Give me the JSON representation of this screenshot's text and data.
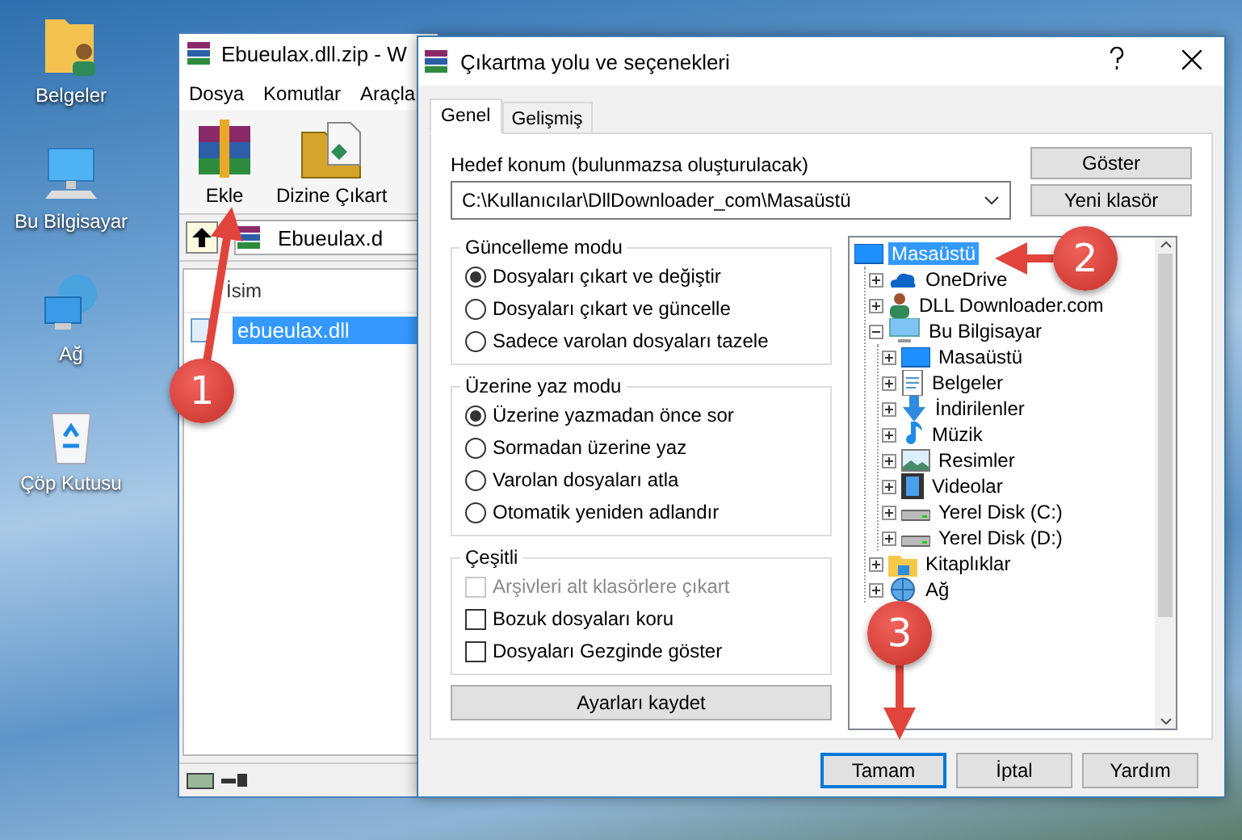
{
  "desktop_icons": [
    {
      "label": "Belgeler",
      "kind": "documents"
    },
    {
      "label": "Bu Bilgisayar",
      "kind": "computer"
    },
    {
      "label": "Ağ",
      "kind": "network"
    },
    {
      "label": "Çöp Kutusu",
      "kind": "recycle"
    }
  ],
  "archive_window": {
    "title": "Ebueulax.dll.zip - W",
    "menu": [
      "Dosya",
      "Komutlar",
      "Araçla"
    ],
    "toolbar": [
      {
        "label": "Ekle",
        "kind": "add"
      },
      {
        "label": "Dizine Çıkart",
        "kind": "extract"
      }
    ],
    "path": "Ebueulax.d",
    "columns": [
      "İsim"
    ],
    "files": [
      {
        "name": "ebueulax.dll",
        "selected": true
      }
    ]
  },
  "dialog": {
    "title": "Çıkartma yolu ve seçenekleri",
    "tabs": [
      {
        "label": "Genel",
        "selected": true
      },
      {
        "label": "Gelişmiş",
        "selected": false
      }
    ],
    "destination": {
      "label": "Hedef konum (bulunmazsa oluşturulacak)",
      "value": "C:\\Kullanıcılar\\DllDownloader_com\\Masaüstü"
    },
    "side_buttons": [
      "Göster",
      "Yeni klasör"
    ],
    "groups": [
      {
        "title": "Güncelleme modu",
        "options": [
          {
            "kind": "radio",
            "label": "Dosyaları çıkart ve değiştir",
            "selected": true
          },
          {
            "kind": "radio",
            "label": "Dosyaları çıkart ve güncelle",
            "selected": false
          },
          {
            "kind": "radio",
            "label": "Sadece varolan dosyaları tazele",
            "selected": false
          }
        ]
      },
      {
        "title": "Üzerine yaz modu",
        "options": [
          {
            "kind": "radio",
            "label": "Üzerine yazmadan önce sor",
            "selected": true
          },
          {
            "kind": "radio",
            "label": "Sormadan üzerine yaz",
            "selected": false
          },
          {
            "kind": "radio",
            "label": "Varolan dosyaları atla",
            "selected": false
          },
          {
            "kind": "radio",
            "label": "Otomatik yeniden adlandır",
            "selected": false
          }
        ]
      },
      {
        "title": "Çeşitli",
        "options": [
          {
            "kind": "checkbox",
            "label": "Arşivleri alt klasörlere çıkart",
            "checked": false,
            "disabled": true
          },
          {
            "kind": "checkbox",
            "label": "Bozuk dosyaları koru",
            "checked": false,
            "disabled": false
          },
          {
            "kind": "checkbox",
            "label": "Dosyaları Gezginde göster",
            "checked": false,
            "disabled": false
          }
        ]
      }
    ],
    "save_button": "Ayarları kaydet",
    "tree": [
      {
        "label": "Masaüstü",
        "kind": "desktop",
        "selected": true,
        "children": [
          {
            "label": "OneDrive",
            "kind": "cloud",
            "selected": false,
            "expanded": false
          },
          {
            "label": "DLL Downloader.com",
            "kind": "user",
            "selected": false,
            "expanded": false
          },
          {
            "label": "Bu Bilgisayar",
            "kind": "computer",
            "selected": false,
            "expanded": true,
            "children": [
              {
                "label": "Masaüstü",
                "kind": "desktop",
                "selected": false,
                "expanded": false
              },
              {
                "label": "Belgeler",
                "kind": "document",
                "selected": false,
                "expanded": false
              },
              {
                "label": "İndirilenler",
                "kind": "download",
                "selected": false,
                "expanded": false
              },
              {
                "label": "Müzik",
                "kind": "music",
                "selected": false,
                "expanded": false
              },
              {
                "label": "Resimler",
                "kind": "pictures",
                "selected": false,
                "expanded": false
              },
              {
                "label": "Videolar",
                "kind": "video",
                "selected": false,
                "expanded": false
              },
              {
                "label": "Yerel Disk (C:)",
                "kind": "disk",
                "selected": false,
                "expanded": false
              },
              {
                "label": "Yerel Disk (D:)",
                "kind": "disk",
                "selected": false,
                "expanded": false
              }
            ]
          },
          {
            "label": "Kitaplıklar",
            "kind": "folder",
            "selected": false,
            "expanded": false
          },
          {
            "label": "Ağ",
            "kind": "network",
            "selected": false,
            "expanded": false
          }
        ]
      }
    ],
    "buttons": [
      {
        "label": "Tamam",
        "default": true
      },
      {
        "label": "İptal",
        "default": false
      },
      {
        "label": "Yardım",
        "default": false
      }
    ]
  },
  "annotations": [
    {
      "number": "1"
    },
    {
      "number": "2"
    },
    {
      "number": "3"
    }
  ]
}
